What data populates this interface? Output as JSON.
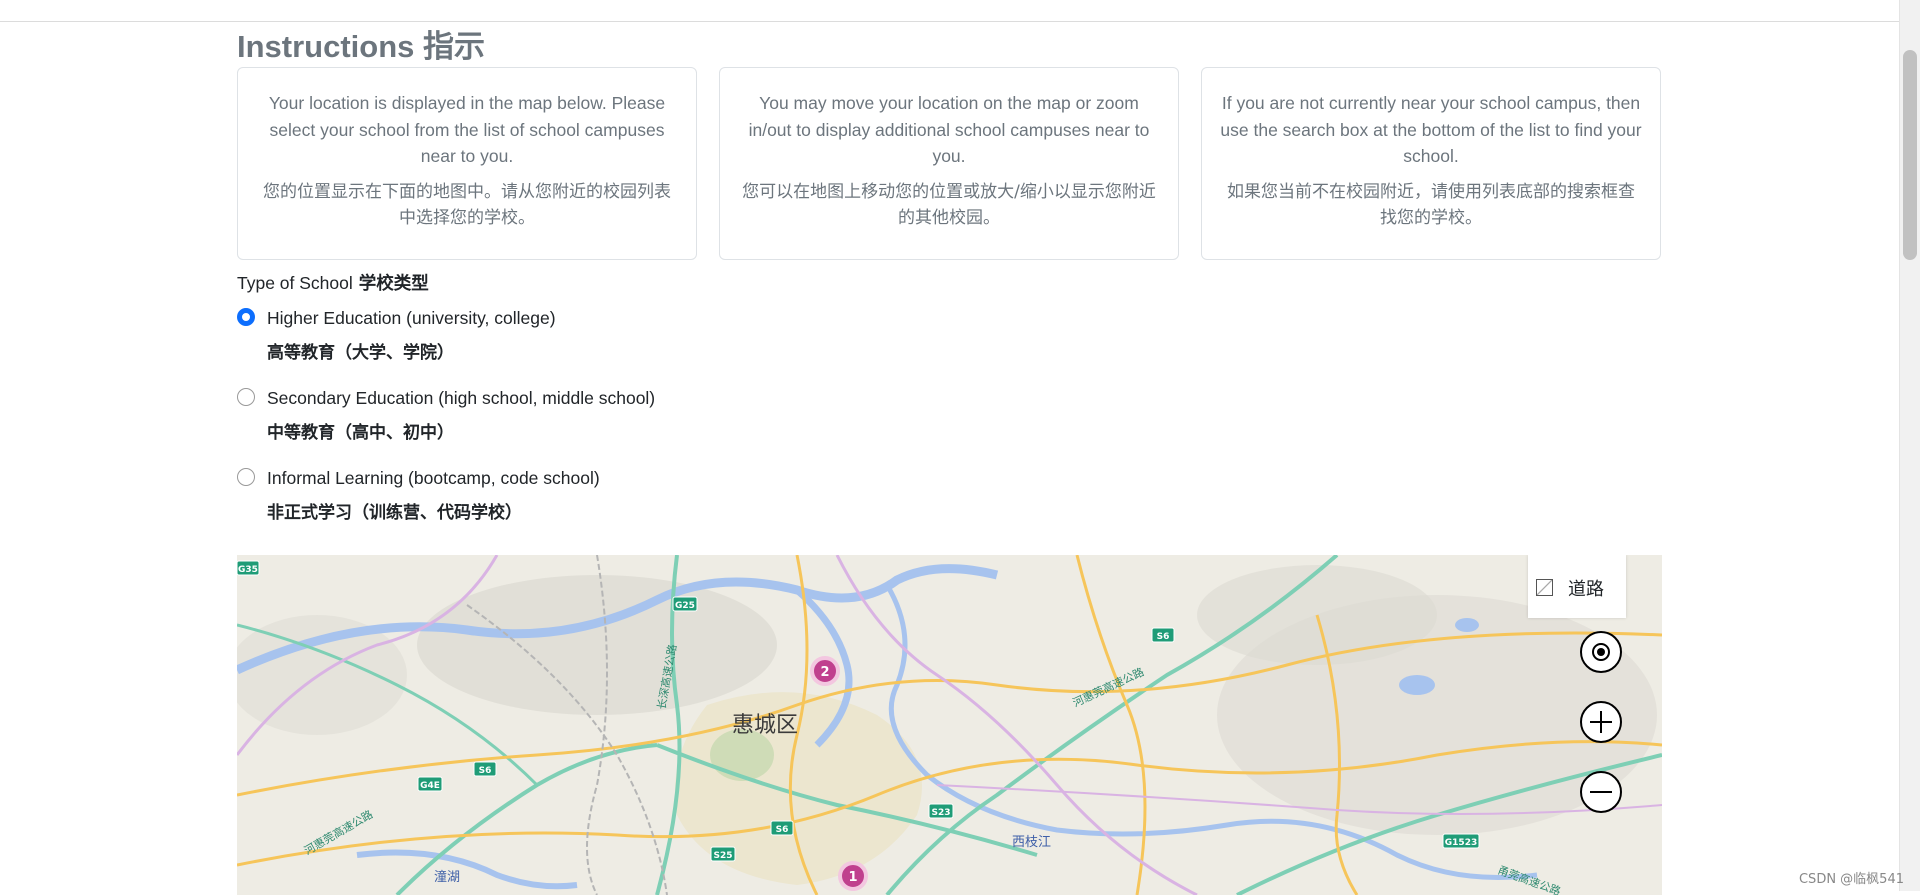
{
  "page": {
    "heading": "Instructions 指示",
    "cards": [
      {
        "en": "Your location is displayed in the map below. Please select your school from the list of school campuses near to you.",
        "zh": "您的位置显示在下面的地图中。请从您附近的校园列表中选择您的学校。"
      },
      {
        "en": "You may move your location on the map or zoom in/out to display additional school campuses near to you.",
        "zh": "您可以在地图上移动您的位置或放大/缩小以显示您附近的其他校园。"
      },
      {
        "en": "If you are not currently near your school campus, then use the search box at the bottom of the list to find your school.",
        "zh": "如果您当前不在校园附近，请使用列表底部的搜索框查找您的学校。"
      }
    ],
    "type_label": "Type of School",
    "type_label_zh": "学校类型",
    "options": [
      {
        "label": "Higher Education (university, college)",
        "zh": "高等教育（大学、学院）",
        "checked": true
      },
      {
        "label": "Secondary Education (high school, middle school)",
        "zh": "中等教育（高中、初中）",
        "checked": false
      },
      {
        "label": "Informal Learning (bootcamp, code school)",
        "zh": "非正式学习（训练营、代码学校）",
        "checked": false
      }
    ]
  },
  "map": {
    "layer_label": "道路",
    "labels": {
      "district": "惠城区",
      "xizhijiang": "西枝江",
      "tonghu": "潼湖",
      "road1": "长深高速公路",
      "road2": "河惠莞高速公路",
      "road3": "河惠莞高速公路",
      "road4": "甬莞高速公路"
    },
    "shields": {
      "g35": "G35",
      "g25": "G25",
      "s6a": "S6",
      "s6b": "S6",
      "s6c": "S6",
      "g4e": "G4E",
      "s23": "S23",
      "s25": "S25",
      "g1523": "G1523"
    },
    "clusters": {
      "c2": "2",
      "c1": "1"
    },
    "icons": {
      "layers": "layers-icon",
      "locate": "locate-icon",
      "zoom_in": "plus-icon",
      "zoom_out": "minus-icon"
    }
  },
  "watermark": "CSDN @临枫541"
}
